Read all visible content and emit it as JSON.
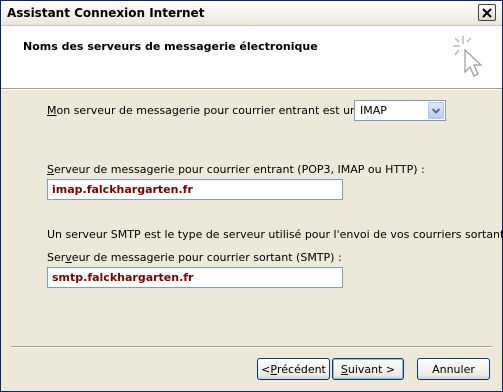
{
  "window": {
    "title": "Assistant Connexion Internet"
  },
  "header": {
    "title": "Noms des serveurs de messagerie électronique"
  },
  "incoming_type": {
    "label_first": "M",
    "label_rest": "on serveur de messagerie pour courrier entrant est un serveur",
    "selected": "IMAP"
  },
  "incoming_server": {
    "label_first": "S",
    "label_rest": "erveur de messagerie pour courrier entrant (POP3, IMAP ou HTTP) :",
    "value": "imap.falckhargarten.fr"
  },
  "smtp_info": "Un serveur SMTP est le type de serveur utilisé pour l'envoi de vos courriers sortants.",
  "outgoing_server": {
    "label_a": "Ser",
    "label_u": "v",
    "label_b": "eur de messagerie pour courrier sortant (SMTP) :",
    "value": "smtp.falckhargarten.fr"
  },
  "buttons": {
    "back_prefix": "< ",
    "back_u": "P",
    "back_rest": "récédent",
    "next_u": "S",
    "next_rest": "uivant >",
    "cancel": "Annuler"
  },
  "icons": {
    "close": "close-icon",
    "wizard": "wand-sparkle-icon",
    "dropdown": "chevron-down-icon"
  }
}
